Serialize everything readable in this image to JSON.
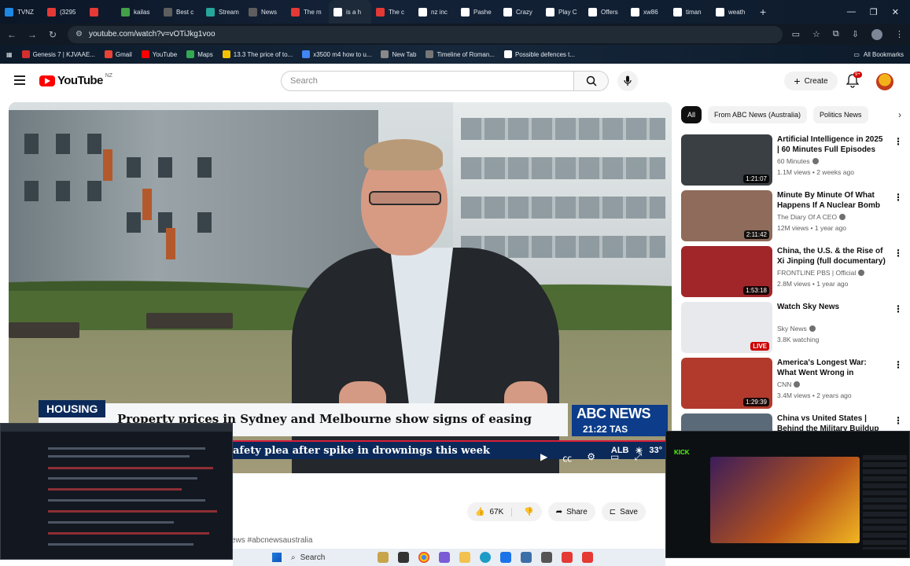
{
  "browser": {
    "tabs": [
      {
        "label": "TVNZ",
        "color": "#1e88e5"
      },
      {
        "label": "(3295",
        "color": "#e53935"
      },
      {
        "label": "",
        "color": "#e53935"
      },
      {
        "label": "kailas",
        "color": "#43a047"
      },
      {
        "label": "Best c",
        "color": "#5e5e5e"
      },
      {
        "label": "Stream",
        "color": "#26a69a"
      },
      {
        "label": "News",
        "color": "#5e5e5e"
      },
      {
        "label": "The m",
        "color": "#e53935"
      },
      {
        "label": "is a h",
        "color": "#ffffff"
      },
      {
        "label": "The c",
        "color": "#e53935"
      },
      {
        "label": "nz inc",
        "color": "#ffffff"
      },
      {
        "label": "Pashe",
        "color": "#ffffff"
      },
      {
        "label": "Crazy",
        "color": "#ffffff"
      },
      {
        "label": "Play C",
        "color": "#ffffff"
      },
      {
        "label": "Offers",
        "color": "#ffffff"
      },
      {
        "label": "xw86",
        "color": "#ffffff"
      },
      {
        "label": "timan",
        "color": "#ffffff"
      },
      {
        "label": "weath",
        "color": "#ffffff"
      }
    ],
    "url": "youtube.com/watch?v=vOTiJkg1voo",
    "bookmarks": [
      {
        "label": "Genesis 7 | KJVAAE...",
        "color": "#d32f2f"
      },
      {
        "label": "Gmail",
        "color": "#ea4335"
      },
      {
        "label": "YouTube",
        "color": "#ff0000"
      },
      {
        "label": "Maps",
        "color": "#34a853"
      },
      {
        "label": "13.3 The price of to...",
        "color": "#f2c200"
      },
      {
        "label": "x3500 m4 how to u...",
        "color": "#4285f4"
      },
      {
        "label": "New Tab",
        "color": "#888888"
      },
      {
        "label": "Timeline of Roman...",
        "color": "#777777"
      },
      {
        "label": "Possible defences t...",
        "color": "#ffffff"
      }
    ],
    "all_bookmarks": "All Bookmarks"
  },
  "youtube": {
    "logo_word": "YouTube",
    "country": "NZ",
    "search_placeholder": "Search",
    "create_label": "Create",
    "notifications_badge": "9+",
    "video": {
      "lower_third_tag": "HOUSING",
      "headline": "Property prices in Sydney and Melbourne show signs of easing",
      "ticker": "afety plea after spike in drownings this week",
      "channel_brand": "ABC NEWS",
      "clock": "21:22 TAS",
      "weather_place": "ALB",
      "weather_temp": "33°"
    },
    "actions": {
      "likes": "67K",
      "share": "Share",
      "save": "Save"
    },
    "description_snippet": "ews #abcnewsaustralia",
    "chips": [
      "All",
      "From ABC News (Australia)",
      "Politics News"
    ],
    "recommendations": [
      {
        "title": "Artificial Intelligence in 2025 | 60 Minutes Full Episodes",
        "channel": "60 Minutes",
        "meta": "1.1M views • 2 weeks ago",
        "duration": "1:21:07",
        "thumb": "#3a3f44"
      },
      {
        "title": "Minute By Minute Of What Happens If A Nuclear Bomb ...",
        "channel": "The Diary Of A CEO",
        "meta": "12M views • 1 year ago",
        "duration": "2:11:42",
        "thumb": "#8e6b5a"
      },
      {
        "title": "China, the U.S. & the Rise of Xi Jinping (full documentary) | ...",
        "channel": "FRONTLINE PBS | Official",
        "meta": "2.8M views • 1 year ago",
        "duration": "1:53:18",
        "thumb": "#a0262a"
      },
      {
        "title": "Watch Sky News",
        "channel": "Sky News",
        "meta": "3.8K watching",
        "duration": "LIVE",
        "thumb": "#e8e9ec"
      },
      {
        "title": "America's Longest War: What Went Wrong in Afghanistan ...",
        "channel": "CNN",
        "meta": "3.4M views • 2 years ago",
        "duration": "1:29:39",
        "thumb": "#b23a2c"
      },
      {
        "title": "China vs United States | Behind the Military Buildup",
        "channel": "",
        "meta": "",
        "duration": "",
        "thumb": "#5a6a78"
      }
    ]
  },
  "taskbar": {
    "search_placeholder": "Search"
  },
  "overlays": {
    "stream_brand": "KICK"
  }
}
